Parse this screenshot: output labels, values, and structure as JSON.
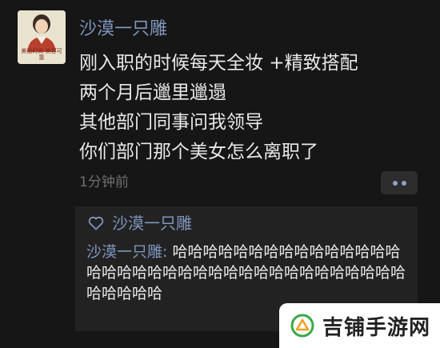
{
  "post": {
    "avatar_caption": "美丽时尚 美容可靠",
    "username": "沙漠一只雕",
    "lines": [
      "刚入职的时候每天全妆 +精致搭配",
      "两个月后邋里邋遢",
      "其他部门同事问我领导",
      "你们部门那个美女怎么离职了"
    ],
    "time": "1分钟前"
  },
  "likes": {
    "icon": "heart-icon",
    "names": "沙漠一只雕"
  },
  "comments": [
    {
      "author": "沙漠一只雕",
      "separator": ": ",
      "text": "哈哈哈哈哈哈哈哈哈哈哈哈哈哈哈哈哈哈哈哈哈哈哈哈哈哈哈哈哈哈哈哈哈哈哈哈哈哈哈哈哈"
    }
  ],
  "watermark": {
    "text": "吉铺手游网",
    "color": "#3aa84a"
  },
  "colors": {
    "background": "#161616",
    "name_link": "#7f95bd",
    "comment_panel": "#222222"
  }
}
